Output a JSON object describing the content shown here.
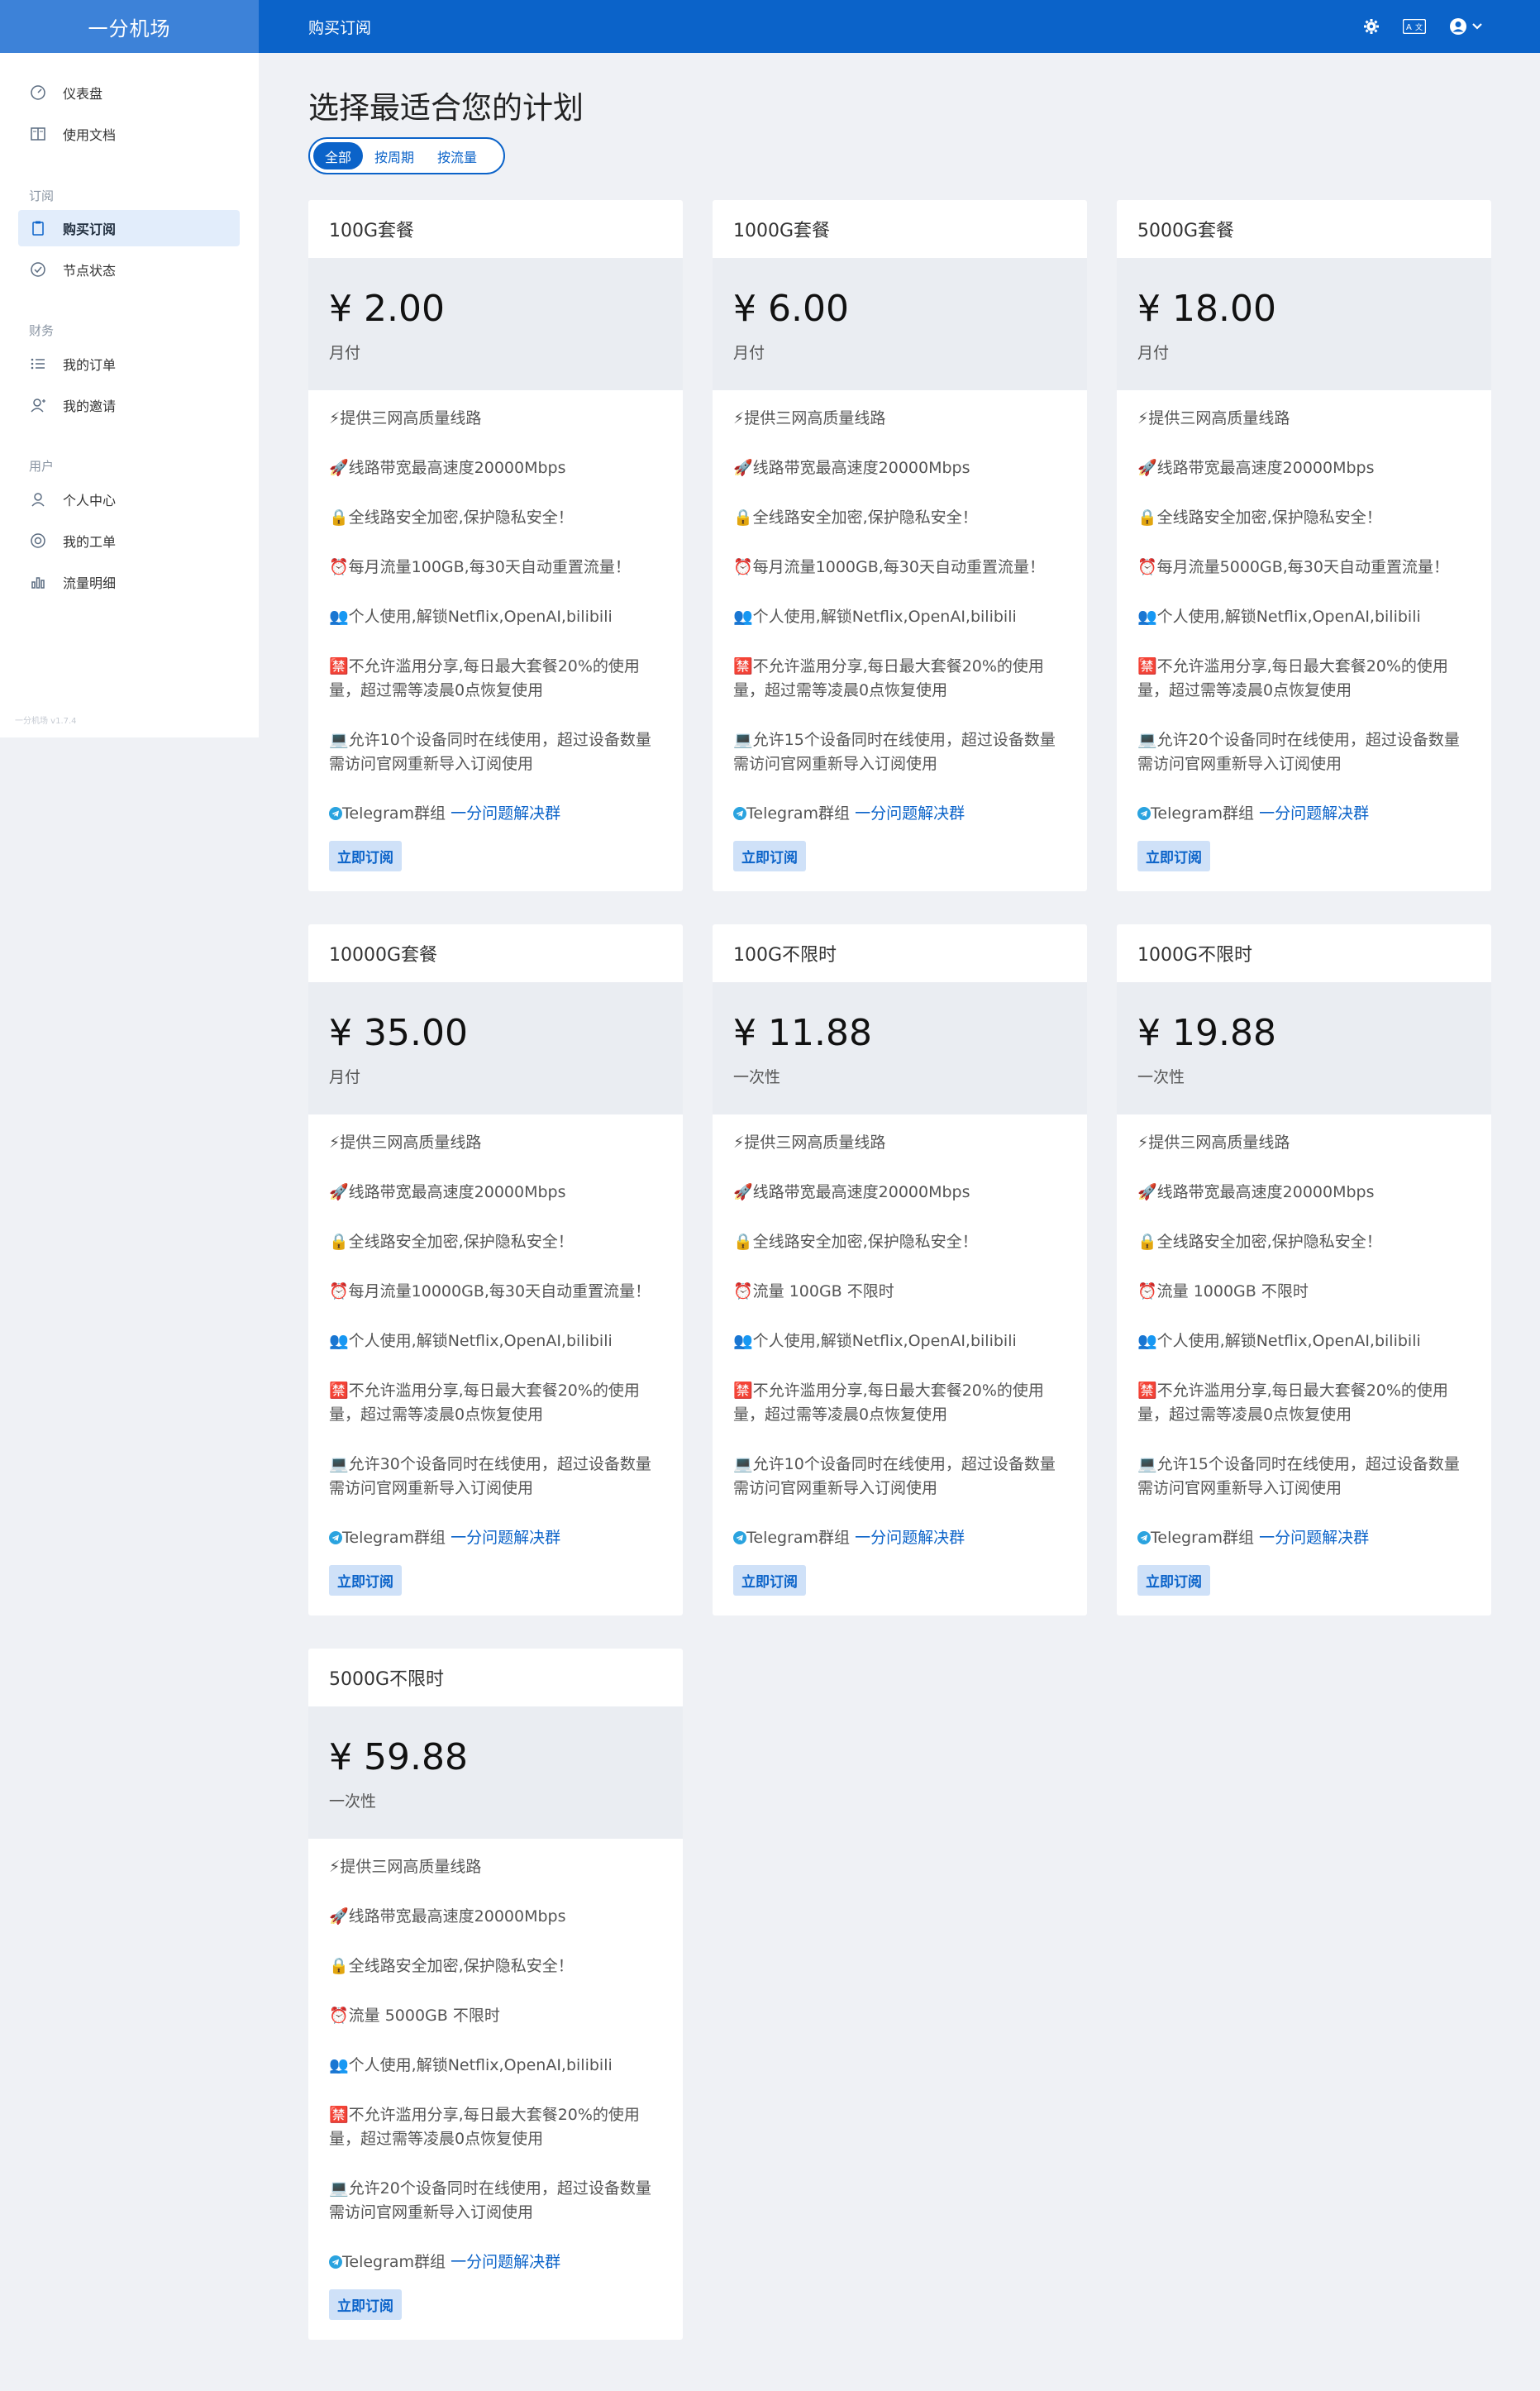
{
  "header": {
    "brand": "一分机场",
    "page_title": "购买订阅",
    "icons": [
      "gear-icon",
      "translate-icon",
      "user-avatar-icon",
      "chevron-down-icon"
    ]
  },
  "sidebar": {
    "items": [
      {
        "label": "仪表盘",
        "icon": "dashboard-icon"
      },
      {
        "label": "使用文档",
        "icon": "book-icon"
      },
      {
        "label": "购买订阅",
        "icon": "clipboard-icon",
        "active": true
      },
      {
        "label": "节点状态",
        "icon": "check-circle-icon"
      },
      {
        "label": "我的订单",
        "icon": "list-icon"
      },
      {
        "label": "我的邀请",
        "icon": "invite-user-icon"
      },
      {
        "label": "个人中心",
        "icon": "user-icon"
      },
      {
        "label": "我的工单",
        "icon": "support-icon"
      },
      {
        "label": "流量明细",
        "icon": "bar-chart-icon"
      }
    ],
    "sections": [
      "订阅",
      "财务",
      "用户"
    ],
    "version": "一分机场 v1.7.4"
  },
  "main": {
    "title": "选择最适合您的计划",
    "tabs": [
      {
        "label": "全部",
        "active": true
      },
      {
        "label": "按周期"
      },
      {
        "label": "按流量"
      }
    ],
    "plans": [
      {
        "name": "100G套餐",
        "price": "¥ 2.00",
        "period": "月付",
        "features": [
          "⚡提供三网高质量线路",
          "🚀线路带宽最高速度20000Mbps",
          "🔒全线路安全加密,保护隐私安全！",
          "⏰每月流量100GB,每30天自动重置流量！",
          "👥个人使用,解锁Netflix,OpenAI,bilibili",
          "🈲不允许滥用分享,每日最大套餐20%的使用量，超过需等凌晨0点恢复使用",
          "💻允许10个设备同时在线使用，超过设备数量需访问官网重新导入订阅使用"
        ],
        "telegram_text": "Telegram群组",
        "telegram_link": "一分问题解决群",
        "button": "立即订阅"
      },
      {
        "name": "1000G套餐",
        "price": "¥ 6.00",
        "period": "月付",
        "features": [
          "⚡提供三网高质量线路",
          "🚀线路带宽最高速度20000Mbps",
          "🔒全线路安全加密,保护隐私安全！",
          "⏰每月流量1000GB,每30天自动重置流量！",
          "👥个人使用,解锁Netflix,OpenAI,bilibili",
          "🈲不允许滥用分享,每日最大套餐20%的使用量，超过需等凌晨0点恢复使用",
          "💻允许15个设备同时在线使用，超过设备数量需访问官网重新导入订阅使用"
        ],
        "telegram_text": "Telegram群组",
        "telegram_link": "一分问题解决群",
        "button": "立即订阅"
      },
      {
        "name": "5000G套餐",
        "price": "¥ 18.00",
        "period": "月付",
        "features": [
          "⚡提供三网高质量线路",
          "🚀线路带宽最高速度20000Mbps",
          "🔒全线路安全加密,保护隐私安全！",
          "⏰每月流量5000GB,每30天自动重置流量！",
          "👥个人使用,解锁Netflix,OpenAI,bilibili",
          "🈲不允许滥用分享,每日最大套餐20%的使用量，超过需等凌晨0点恢复使用",
          "💻允许20个设备同时在线使用，超过设备数量需访问官网重新导入订阅使用"
        ],
        "telegram_text": "Telegram群组",
        "telegram_link": "一分问题解决群",
        "button": "立即订阅"
      },
      {
        "name": "10000G套餐",
        "price": "¥ 35.00",
        "period": "月付",
        "features": [
          "⚡提供三网高质量线路",
          "🚀线路带宽最高速度20000Mbps",
          "🔒全线路安全加密,保护隐私安全！",
          "⏰每月流量10000GB,每30天自动重置流量！",
          "👥个人使用,解锁Netflix,OpenAI,bilibili",
          "🈲不允许滥用分享,每日最大套餐20%的使用量，超过需等凌晨0点恢复使用",
          "💻允许30个设备同时在线使用，超过设备数量需访问官网重新导入订阅使用"
        ],
        "telegram_text": "Telegram群组",
        "telegram_link": "一分问题解决群",
        "button": "立即订阅"
      },
      {
        "name": "100G不限时",
        "price": "¥ 11.88",
        "period": "一次性",
        "features": [
          "⚡提供三网高质量线路",
          "🚀线路带宽最高速度20000Mbps",
          "🔒全线路安全加密,保护隐私安全！",
          "⏰流量 100GB 不限时",
          "👥个人使用,解锁Netflix,OpenAI,bilibili",
          "🈲不允许滥用分享,每日最大套餐20%的使用量，超过需等凌晨0点恢复使用",
          "💻允许10个设备同时在线使用，超过设备数量需访问官网重新导入订阅使用"
        ],
        "telegram_text": "Telegram群组",
        "telegram_link": "一分问题解决群",
        "button": "立即订阅"
      },
      {
        "name": "1000G不限时",
        "price": "¥ 19.88",
        "period": "一次性",
        "features": [
          "⚡提供三网高质量线路",
          "🚀线路带宽最高速度20000Mbps",
          "🔒全线路安全加密,保护隐私安全！",
          "⏰流量 1000GB 不限时",
          "👥个人使用,解锁Netflix,OpenAI,bilibili",
          "🈲不允许滥用分享,每日最大套餐20%的使用量，超过需等凌晨0点恢复使用",
          "💻允许15个设备同时在线使用，超过设备数量需访问官网重新导入订阅使用"
        ],
        "telegram_text": "Telegram群组",
        "telegram_link": "一分问题解决群",
        "button": "立即订阅"
      },
      {
        "name": "5000G不限时",
        "price": "¥ 59.88",
        "period": "一次性",
        "features": [
          "⚡提供三网高质量线路",
          "🚀线路带宽最高速度20000Mbps",
          "🔒全线路安全加密,保护隐私安全！",
          "⏰流量 5000GB 不限时",
          "👥个人使用,解锁Netflix,OpenAI,bilibili",
          "🈲不允许滥用分享,每日最大套餐20%的使用量，超过需等凌晨0点恢复使用",
          "💻允许20个设备同时在线使用，超过设备数量需访问官网重新导入订阅使用"
        ],
        "telegram_text": "Telegram群组",
        "telegram_link": "一分问题解决群",
        "button": "立即订阅"
      }
    ]
  },
  "colors": {
    "primary": "#0b63c9",
    "brand_bg": "#3d82d8",
    "page_bg": "#eff1f5",
    "price_bg": "#eaedf2",
    "active_nav_bg": "#e2edfb",
    "button_bg": "#cfe1f8"
  }
}
